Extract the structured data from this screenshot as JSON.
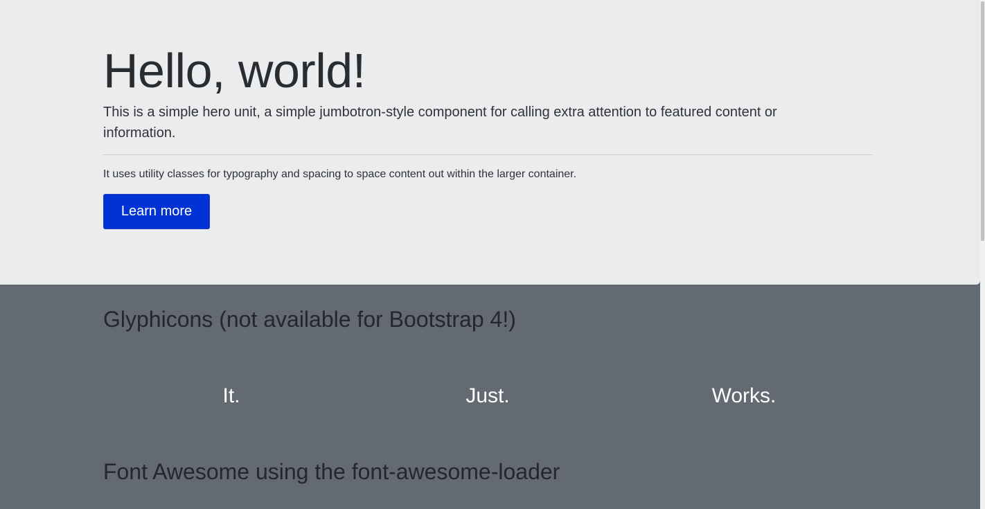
{
  "hero": {
    "title": "Hello, world!",
    "lead": "This is a simple hero unit, a simple jumbotron-style component for calling extra attention to featured content or information.",
    "body": "It uses utility classes for typography and spacing to space content out within the larger container.",
    "button_label": "Learn more"
  },
  "glyphicons": {
    "title": "Glyphicons (not available for Bootstrap 4!)",
    "words": [
      "It.",
      "Just.",
      "Works."
    ]
  },
  "font_awesome": {
    "title": "Font Awesome using the font-awesome-loader"
  },
  "colors": {
    "hero_background": "#ebecee",
    "page_background": "#636a72",
    "button": "#0132d6"
  }
}
